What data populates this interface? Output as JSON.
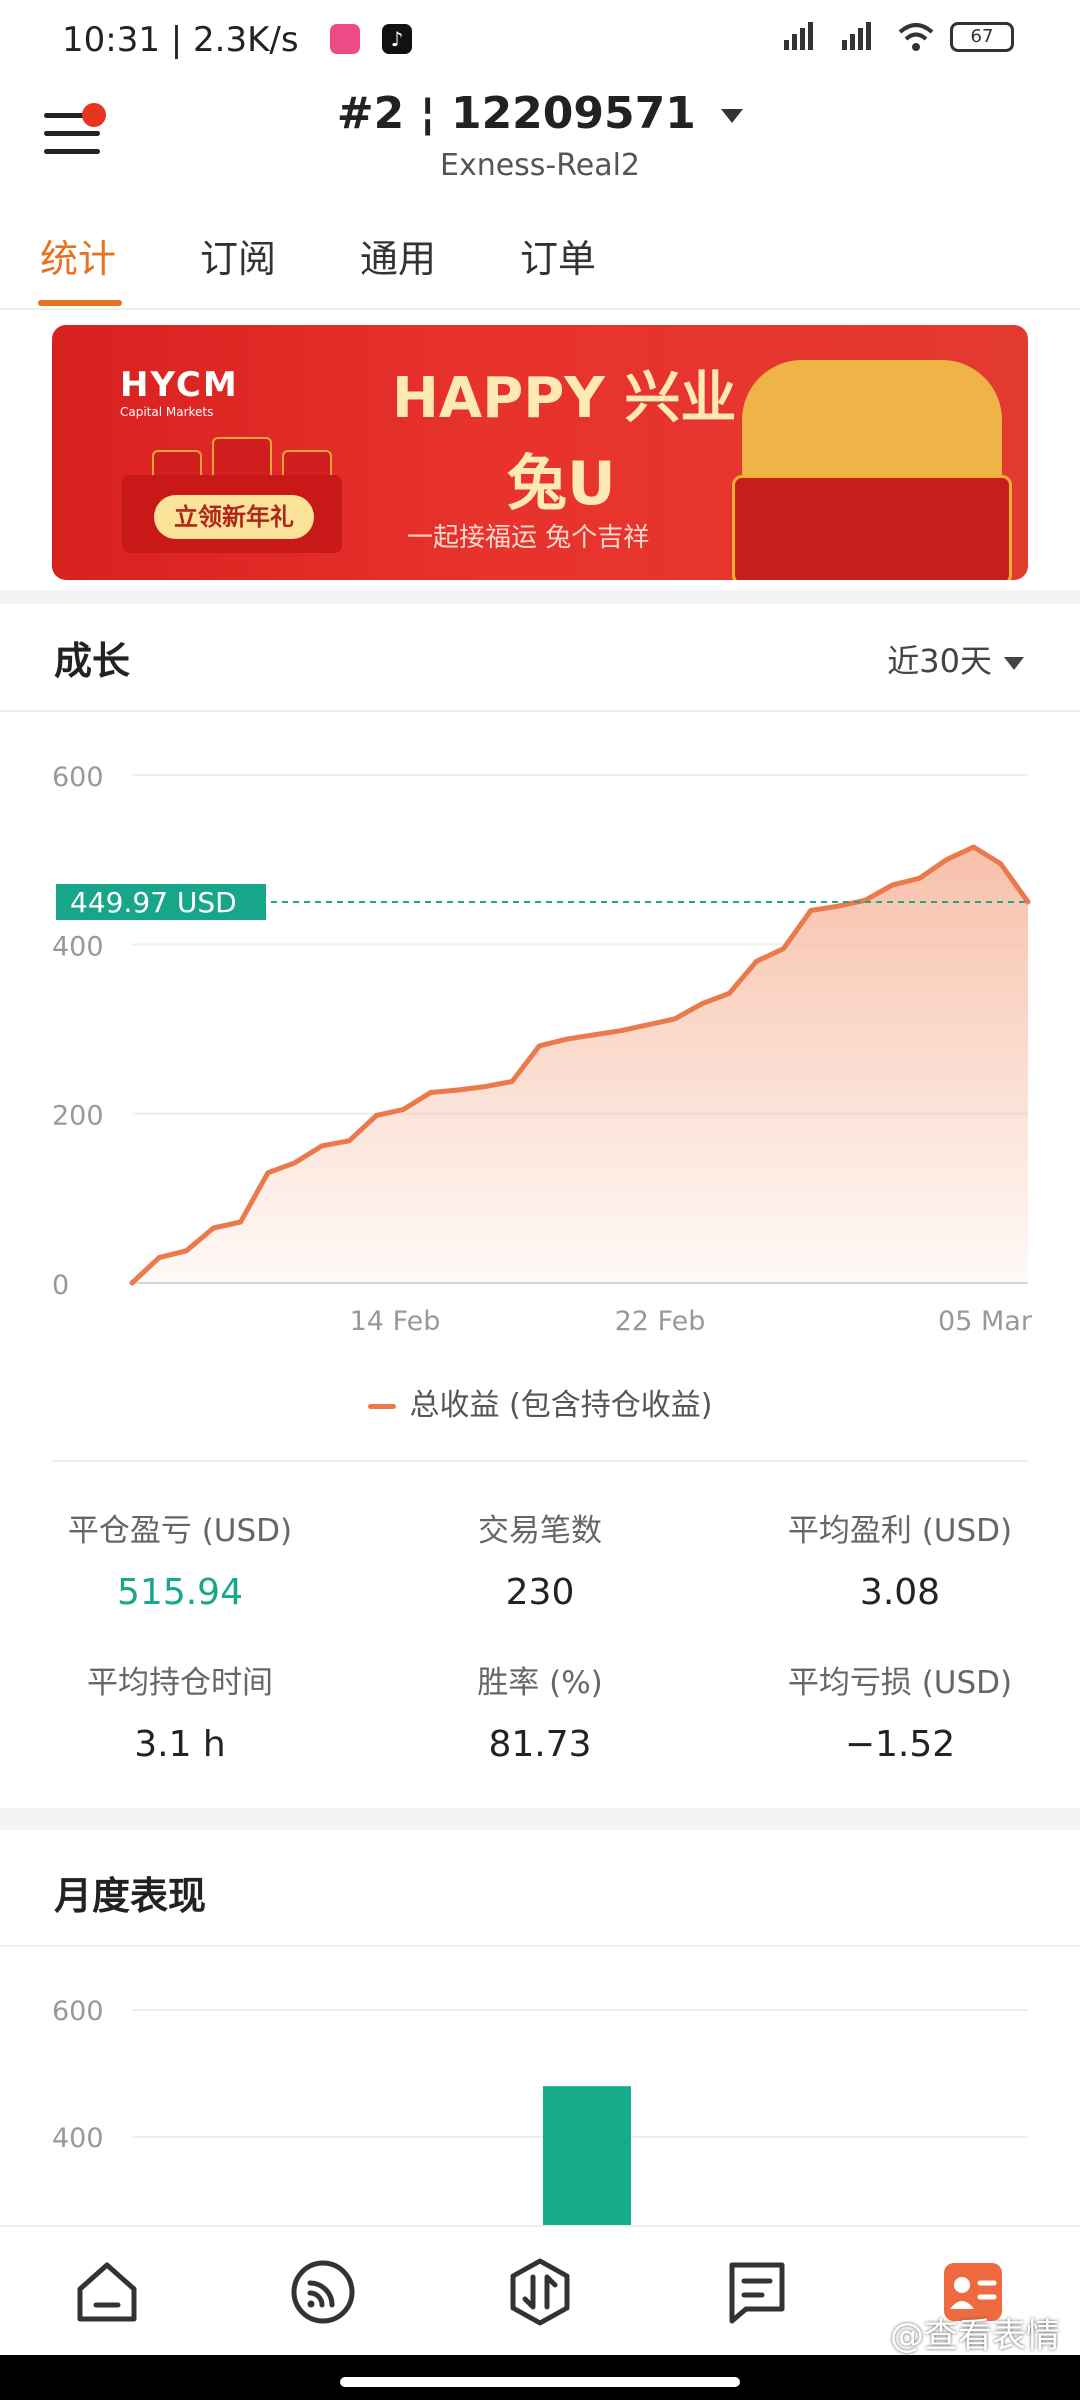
{
  "status_bar": {
    "time_speed": "10:31 | 2.3K/s",
    "battery": "67",
    "icons": [
      "mute-icon",
      "app-icon",
      "tiktok-icon",
      "signal-icon",
      "wifi-icon",
      "battery-icon"
    ]
  },
  "header": {
    "account_number": "#2 ¦ 12209571",
    "server": "Exness-Real2"
  },
  "tabs": [
    {
      "label": "统计",
      "active": true
    },
    {
      "label": "订阅",
      "active": false
    },
    {
      "label": "通用",
      "active": false
    },
    {
      "label": "订单",
      "active": false
    }
  ],
  "banner": {
    "logo": "HYCM",
    "logo_sub": "Capital Markets",
    "cta": "立领新年礼",
    "title_line1": "HAPPY 兴业",
    "title_line2": "兔U",
    "subtitle": "一起接福运 兔个吉祥"
  },
  "growth": {
    "title": "成长",
    "range": "近30天",
    "current_label": "449.97 USD",
    "legend": "总收益 (包含持仓收益)"
  },
  "chart_data": [
    {
      "type": "area",
      "title": "成长",
      "x_ticks": [
        "14 Feb",
        "22 Feb",
        "05 Mar"
      ],
      "y_ticks": [
        0,
        200,
        400,
        600
      ],
      "ylim": [
        0,
        600
      ],
      "series": [
        {
          "name": "总收益 (包含持仓收益)",
          "values": [
            0,
            30,
            38,
            65,
            72,
            130,
            142,
            162,
            168,
            198,
            205,
            225,
            228,
            232,
            238,
            280,
            288,
            293,
            298,
            305,
            312,
            330,
            342,
            380,
            395,
            440,
            445,
            452,
            470,
            478,
            500,
            515,
            495,
            449.97
          ]
        }
      ],
      "reference_line": 449.97,
      "area_color": "#f7b9a0",
      "line_color": "#ea7a4c"
    },
    {
      "type": "bar",
      "title": "月度表现",
      "y_ticks": [
        400,
        600
      ],
      "values": [
        480
      ],
      "bar_color": "#17ab8c"
    }
  ],
  "stats": [
    {
      "label": "平仓盈亏 (USD)",
      "value": "515.94",
      "green": true
    },
    {
      "label": "交易笔数",
      "value": "230",
      "green": false
    },
    {
      "label": "平均盈利 (USD)",
      "value": "3.08",
      "green": false
    },
    {
      "label": "平均持仓时间",
      "value": "3.1 h",
      "green": false
    },
    {
      "label": "胜率 (%)",
      "value": "81.73",
      "green": false
    },
    {
      "label": "平均亏损 (USD)",
      "value": "−1.52",
      "green": false
    }
  ],
  "monthly": {
    "title": "月度表现"
  },
  "nav": [
    {
      "icon": "home-icon"
    },
    {
      "icon": "feed-icon"
    },
    {
      "icon": "trade-icon"
    },
    {
      "icon": "message-icon"
    },
    {
      "icon": "profile-icon",
      "active": true
    }
  ],
  "watermark": "@查看表情"
}
